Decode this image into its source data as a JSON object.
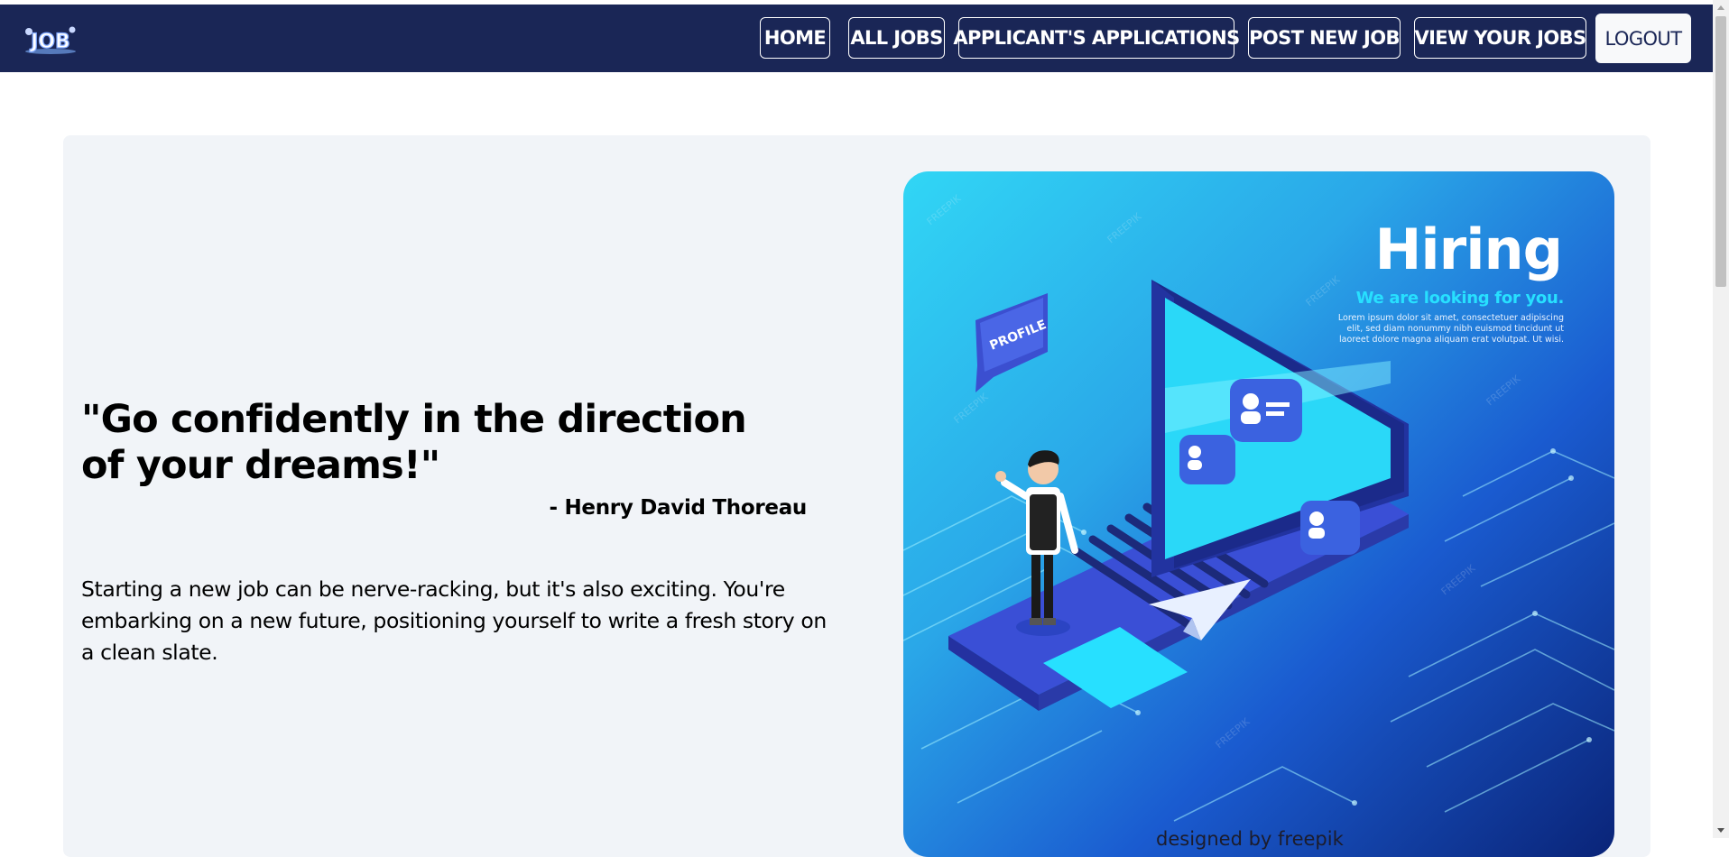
{
  "nav": {
    "logo_text": "JOB",
    "items": [
      {
        "label": "HOME"
      },
      {
        "label": "ALL JOBS"
      },
      {
        "label": "APPLICANT'S APPLICATIONS"
      },
      {
        "label": "POST NEW JOB"
      },
      {
        "label": "VIEW YOUR JOBS"
      }
    ],
    "logout_label": "LOGOUT"
  },
  "hero": {
    "quote": "\"Go confidently in the direction of your dreams!\"",
    "author": "- Henry David Thoreau",
    "intro": "Starting a new job can be nerve-racking, but it's also exciting. You're embarking on a new future, positioning yourself to write a fresh story on a clean slate."
  },
  "banner": {
    "title": "Hiring",
    "subtitle": "We are looking for you.",
    "body": "Lorem ipsum dolor sit amet, consectetuer adipiscing elit, sed diam nonummy nibh euismod tincidunt ut laoreet dolore magna aliquam erat volutpat. Ut wisi.",
    "bubble_label": "PROFILE",
    "watermark": "FREEPIK",
    "credit": "designed by freepik"
  },
  "colors": {
    "navbar": "#1a2656",
    "hero_bg": "#f1f4f8",
    "accent_cyan": "#27e0ff"
  }
}
